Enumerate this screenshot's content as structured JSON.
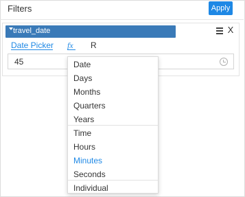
{
  "panel": {
    "title": "Filters",
    "apply_label": "Apply"
  },
  "field": {
    "name": "travel_date",
    "menu_icon": "list-icon",
    "close_label": "X"
  },
  "tabs": [
    {
      "label": "Date Picker",
      "active": true
    },
    {
      "label": "fx",
      "active": false
    },
    {
      "label": "R",
      "active": false
    }
  ],
  "input": {
    "value": "45",
    "icon": "clock-icon"
  },
  "dropdown": {
    "items": [
      "Date",
      "Days",
      "Months",
      "Quarters",
      "Years",
      "Time",
      "Hours",
      "Minutes",
      "Seconds",
      "Individual"
    ],
    "selected": "Minutes"
  },
  "colors": {
    "accent": "#1e88e5",
    "field_bar": "#3a7ab8"
  }
}
